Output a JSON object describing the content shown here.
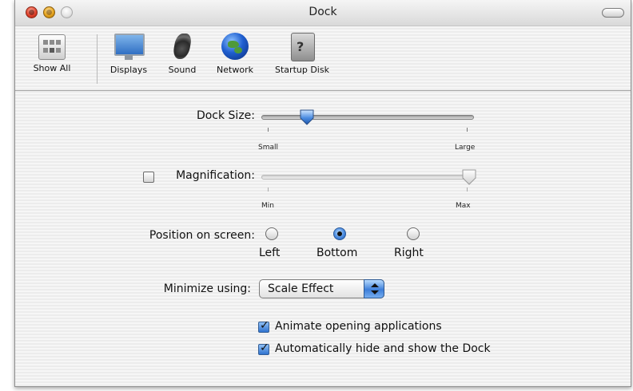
{
  "window": {
    "title": "Dock"
  },
  "toolbar": {
    "items": [
      {
        "label": "Show All",
        "icon": "show-all-icon"
      },
      {
        "label": "Displays",
        "icon": "displays-icon"
      },
      {
        "label": "Sound",
        "icon": "sound-icon"
      },
      {
        "label": "Network",
        "icon": "network-icon"
      },
      {
        "label": "Startup Disk",
        "icon": "startup-disk-icon"
      }
    ]
  },
  "dock_size": {
    "label": "Dock Size:",
    "min_label": "Small",
    "max_label": "Large",
    "value": 0.2
  },
  "magnification": {
    "label": "Magnification:",
    "checked": false,
    "min_label": "Min",
    "max_label": "Max",
    "value": 1.0
  },
  "position": {
    "label": "Position on screen:",
    "options": [
      "Left",
      "Bottom",
      "Right"
    ],
    "selected": "Bottom"
  },
  "minimize": {
    "label": "Minimize using:",
    "value": "Scale Effect"
  },
  "checkboxes": [
    {
      "label": "Animate opening applications",
      "checked": true
    },
    {
      "label": "Automatically hide and show the Dock",
      "checked": true
    }
  ],
  "colors": {
    "accent": "#3d7ed9",
    "window_bg": "#ececec"
  }
}
